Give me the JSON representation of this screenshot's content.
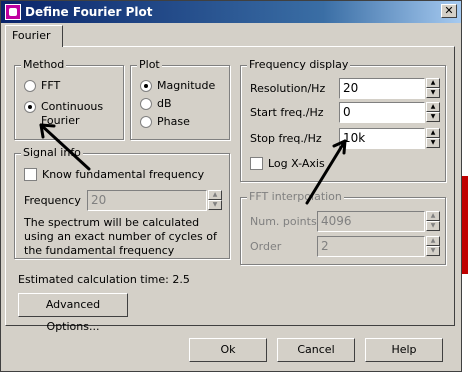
{
  "window": {
    "title": "Define Fourier Plot",
    "close_glyph": "✕"
  },
  "tab": {
    "label": "Fourier"
  },
  "method": {
    "legend": "Method",
    "options": [
      "FFT",
      "Continuous",
      "Fourier"
    ],
    "selected": "Continuous Fourier"
  },
  "plot": {
    "legend": "Plot",
    "options": [
      "Magnitude",
      "dB",
      "Phase"
    ],
    "selected": "Magnitude"
  },
  "frequency_display": {
    "legend": "Frequency display",
    "resolution_label": "Resolution/Hz",
    "resolution_value": "20",
    "start_label": "Start freq./Hz",
    "start_value": "0",
    "stop_label": "Stop freq./Hz",
    "stop_value": "10k",
    "log_x_label": "Log X-Axis"
  },
  "signal_info": {
    "legend": "Signal info",
    "know_fundamental_label": "Know fundamental frequency",
    "frequency_label": "Frequency",
    "frequency_value": "20",
    "note": "The spectrum will be calculated using an exact number of cycles of the fundamental frequency"
  },
  "fft_interpolation": {
    "legend": "FFT interpolation",
    "num_points_label": "Num. points",
    "num_points_value": "4096",
    "order_label": "Order",
    "order_value": "2"
  },
  "estimate": {
    "text": "Estimated calculation time:  2.5"
  },
  "buttons": {
    "advanced": "Advanced Options...",
    "ok": "Ok",
    "cancel": "Cancel",
    "help": "Help"
  },
  "icons": {
    "spin_up": "▲",
    "spin_down": "▼"
  }
}
